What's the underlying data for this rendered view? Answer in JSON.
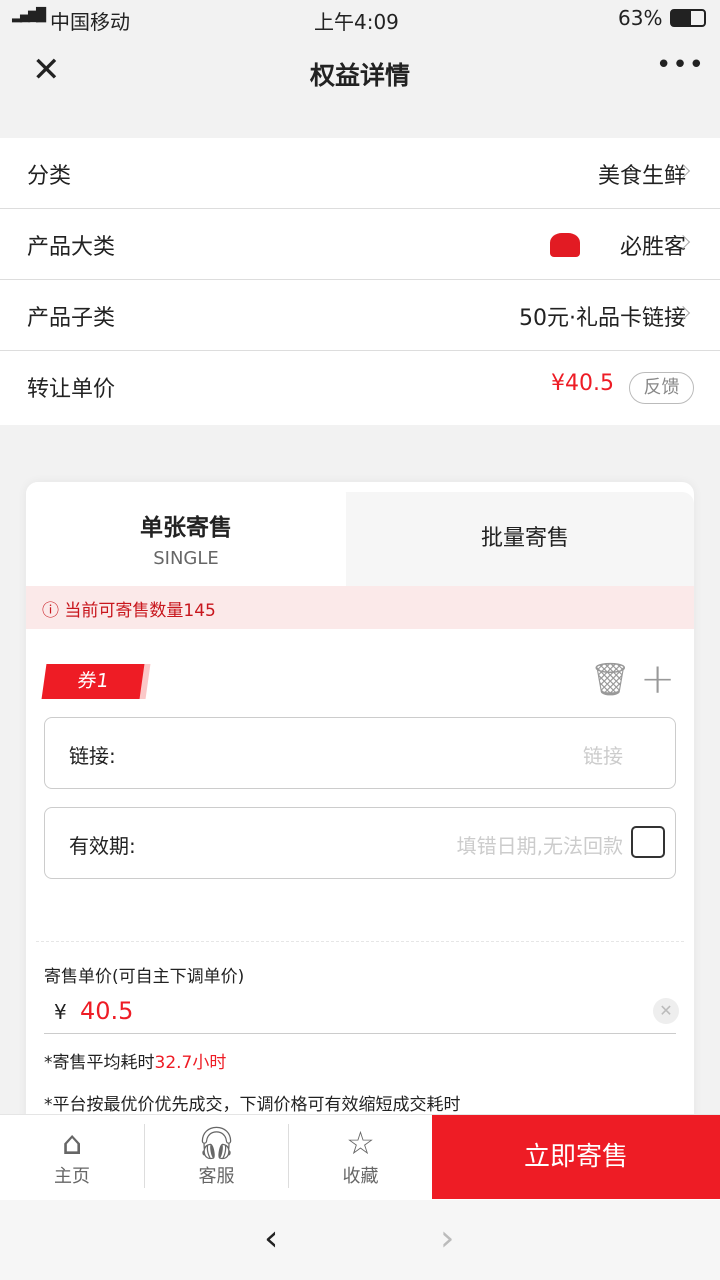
{
  "status": {
    "carrier": "中国移动",
    "time": "上午4:09",
    "battery": "63%"
  },
  "nav": {
    "title": "权益详情"
  },
  "info": [
    {
      "label": "分类",
      "value": "美食生鲜"
    },
    {
      "label": "产品大类",
      "value": "必胜客"
    },
    {
      "label": "产品子类",
      "value": "50元·礼品卡链接"
    },
    {
      "label": "转让单价",
      "value": "¥40.5",
      "feedback": "反馈"
    }
  ],
  "tabs": [
    {
      "label": "单张寄售",
      "sub": "SINGLE"
    },
    {
      "label": "批量寄售"
    }
  ],
  "notice": "当前可寄售数量145",
  "coupon": {
    "tag": "券1",
    "link_label": "链接:",
    "link_placeholder": "链接",
    "expiry_label": "有效期:",
    "expiry_placeholder": "填错日期,无法回款"
  },
  "price": {
    "label": "寄售单价(可自主下调单价)",
    "currency": "¥",
    "value": "40.5",
    "avg_prefix": "*寄售平均耗时",
    "avg_value": "32.7小时",
    "note": "*平台按最优价优先成交，下调价格可有效缩短成交耗时"
  },
  "bottom": {
    "home": "主页",
    "service": "客服",
    "fav": "收藏",
    "submit": "立即寄售"
  },
  "colors": {
    "accent": "#ee1c25"
  }
}
